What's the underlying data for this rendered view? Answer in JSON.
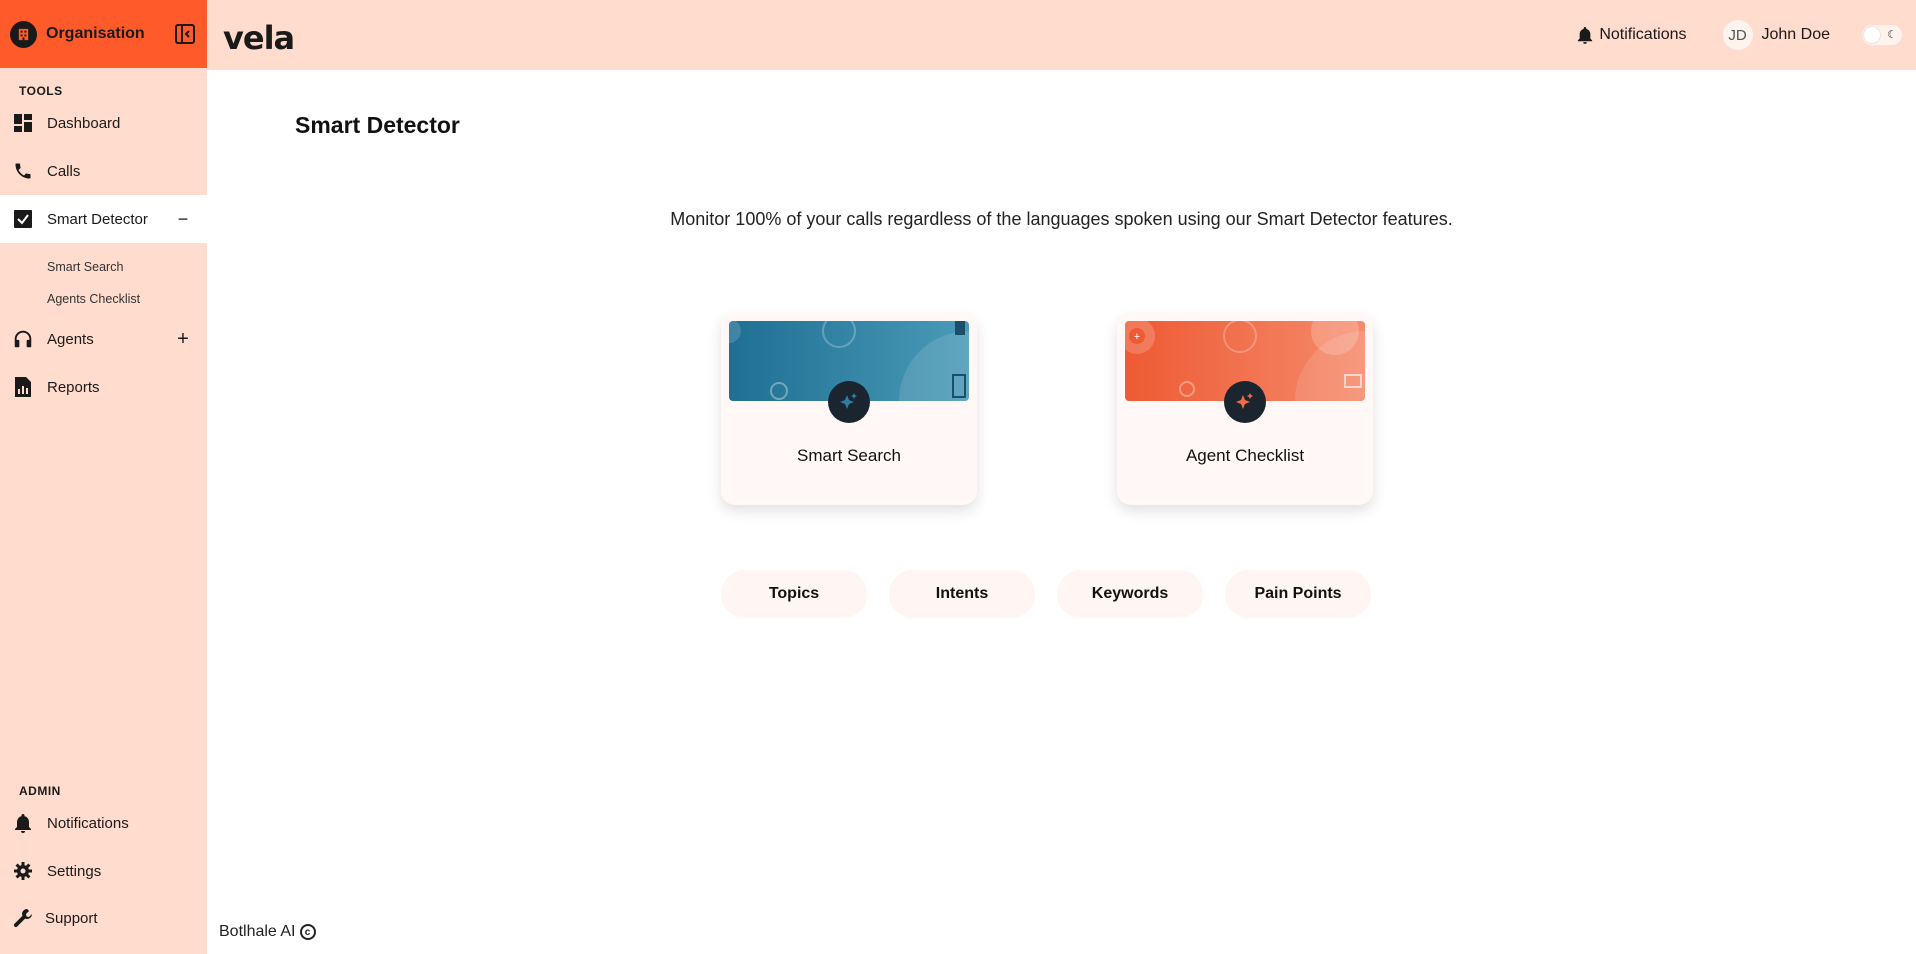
{
  "sidebar": {
    "org_name": "Organisation",
    "tools_label": "TOOLS",
    "admin_label": "ADMIN",
    "items": [
      {
        "label": "Dashboard"
      },
      {
        "label": "Calls"
      },
      {
        "label": "Smart Detector",
        "toggle": "−"
      },
      {
        "label": "Agents",
        "toggle": "+"
      },
      {
        "label": "Reports"
      }
    ],
    "sub_items": [
      {
        "label": "Smart Search"
      },
      {
        "label": "Agents Checklist"
      }
    ],
    "admin_items": [
      {
        "label": "Notifications"
      },
      {
        "label": "Settings"
      },
      {
        "label": "Support"
      }
    ]
  },
  "header": {
    "logo_text": "vela",
    "notifications_label": "Notifications",
    "user_initials": "JD",
    "user_name": "John Doe",
    "theme_icon": "☾"
  },
  "main": {
    "title": "Smart Detector",
    "intro": "Monitor 100% of your calls regardless of the languages spoken using our Smart Detector features.",
    "cards": [
      {
        "label": "Smart Search",
        "color": "#2b7fa3"
      },
      {
        "label": "Agent Checklist",
        "color": "#f26b45"
      }
    ],
    "chips": [
      {
        "label": "Topics"
      },
      {
        "label": "Intents"
      },
      {
        "label": "Keywords"
      },
      {
        "label": "Pain Points"
      }
    ]
  },
  "footer": {
    "text": "Botlhale AI",
    "symbol": "c"
  },
  "colors": {
    "accent": "#ff5a2a",
    "sidebar_bg": "#ffdccd",
    "chip_bg": "#fff5f2"
  }
}
